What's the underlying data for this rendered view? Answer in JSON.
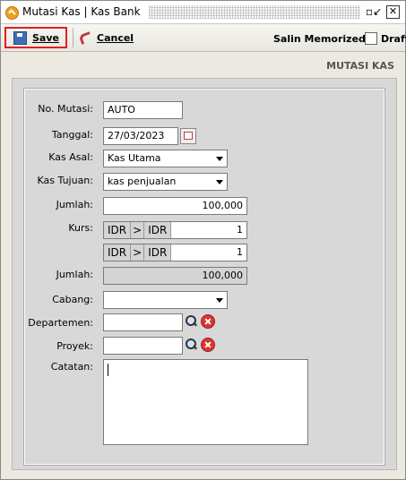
{
  "window": {
    "title": "Mutasi Kas | Kas Bank",
    "restore_icon": "restore-icon",
    "close_icon": "close-icon"
  },
  "toolbar": {
    "save_label": "Save",
    "cancel_label": "Cancel",
    "salin_label": "Salin Memorized",
    "draft_label": "Draft",
    "draft_checked": false
  },
  "header": {
    "title": "MUTASI KAS"
  },
  "form": {
    "no_mutasi": {
      "label": "No. Mutasi:",
      "value": "AUTO"
    },
    "tanggal": {
      "label": "Tanggal:",
      "value": "27/03/2023"
    },
    "kas_asal": {
      "label": "Kas Asal:",
      "value": "Kas Utama"
    },
    "kas_tujuan": {
      "label": "Kas Tujuan:",
      "value": "kas penjualan"
    },
    "jumlah": {
      "label": "Jumlah:",
      "value": "100,000"
    },
    "kurs": {
      "label": "Kurs:",
      "rows": [
        {
          "from": "IDR",
          "sep": ">",
          "to": "IDR",
          "value": "1"
        },
        {
          "from": "IDR",
          "sep": ">",
          "to": "IDR",
          "value": "1"
        }
      ]
    },
    "jumlah_ro": {
      "label": "Jumlah:",
      "value": "100,000"
    },
    "cabang": {
      "label": "Cabang:",
      "value": ""
    },
    "departemen": {
      "label": "Departemen:",
      "value": ""
    },
    "proyek": {
      "label": "Proyek:",
      "value": ""
    },
    "catatan": {
      "label": "Catatan:",
      "value": ""
    }
  }
}
